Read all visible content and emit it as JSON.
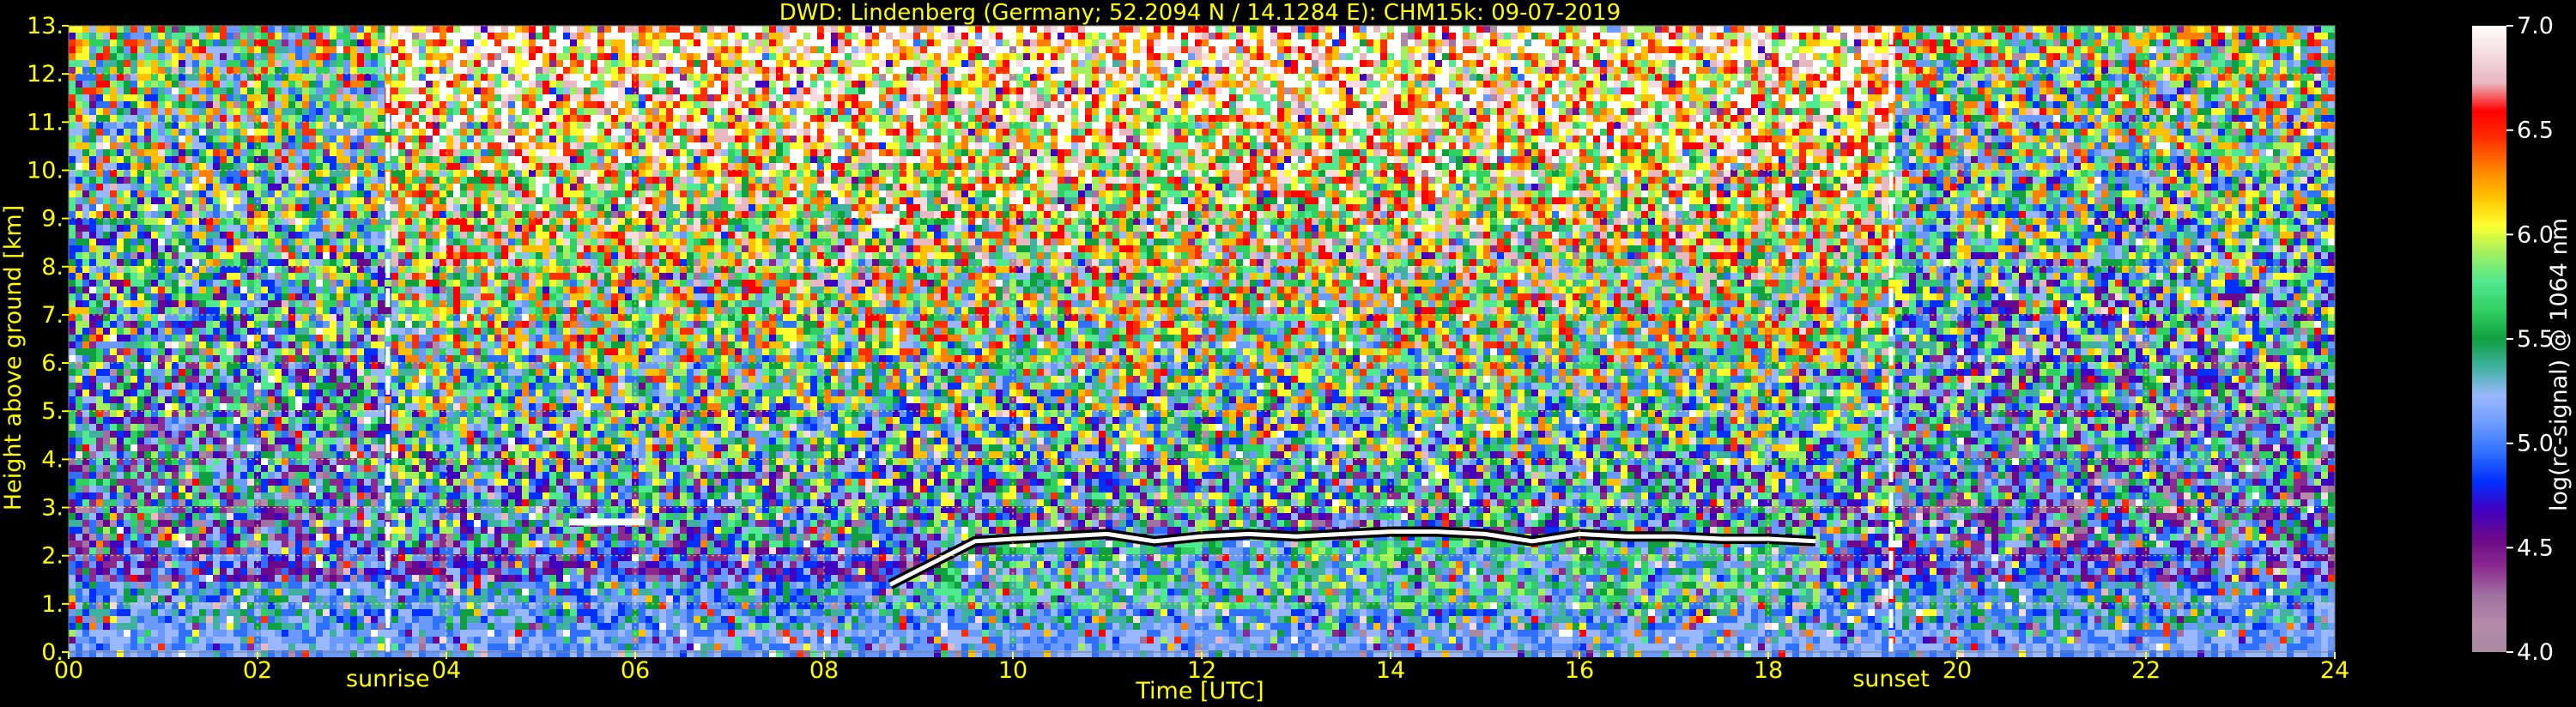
{
  "chart_data": {
    "type": "heatmap",
    "title": "DWD: Lindenberg (Germany; 52.2094 N / 14.1284 E):    CHM15k: 09-07-2019",
    "xlabel": "Time [UTC]",
    "ylabel": "Height above ground [km]",
    "xlim": [
      0,
      24
    ],
    "ylim": [
      0,
      13
    ],
    "x_ticks": [
      0,
      2,
      4,
      6,
      8,
      10,
      12,
      14,
      16,
      18,
      20,
      22,
      24
    ],
    "x_tick_labels": [
      "00",
      "02",
      "04",
      "06",
      "08",
      "10",
      "12",
      "14",
      "16",
      "18",
      "20",
      "22",
      "24"
    ],
    "y_ticks": [
      0,
      1,
      2,
      3,
      4,
      5,
      6,
      7,
      8,
      9,
      10,
      11,
      12,
      13
    ],
    "y_tick_labels": [
      "0.",
      "1.",
      "2.",
      "3.",
      "4.",
      "5.",
      "6.",
      "7.",
      "8.",
      "9.",
      "10.",
      "11.",
      "12.",
      "13."
    ],
    "grid": true,
    "grid_color": "#ffff00",
    "text_color": "#ffff00",
    "background": "#000000",
    "annotations": [
      {
        "label": "sunrise",
        "x": 3.38
      },
      {
        "label": "sunset",
        "x": 19.3
      }
    ],
    "colorbar": {
      "label": "log(rc-signal) @ 1064 nm",
      "range": [
        4.0,
        7.0
      ],
      "ticks": [
        4.0,
        4.5,
        5.0,
        5.5,
        6.0,
        6.5,
        7.0
      ],
      "tick_labels": [
        "4.0",
        "4.5",
        "5.0",
        "5.5",
        "6.0",
        "6.5",
        "7.0"
      ],
      "colors": [
        "#a88ba0",
        "#b48aa8",
        "#a070a0",
        "#8a2a8e",
        "#6a0a8a",
        "#4000c0",
        "#0030ff",
        "#3070ff",
        "#6a9aff",
        "#9ab8ff",
        "#40b0a0",
        "#10a040",
        "#30d060",
        "#50e890",
        "#a0f060",
        "#ffff30",
        "#ffc000",
        "#ff8000",
        "#ff3000",
        "#ff0000",
        "#e8b8c0",
        "#f4dce0",
        "#ffffff"
      ]
    },
    "features": [
      {
        "type": "boundary_layer_top",
        "points": [
          [
            8.7,
            1.4
          ],
          [
            9.0,
            1.7
          ],
          [
            9.3,
            2.0
          ],
          [
            9.6,
            2.3
          ],
          [
            10.0,
            2.35
          ],
          [
            10.5,
            2.4
          ],
          [
            11.0,
            2.45
          ],
          [
            11.5,
            2.3
          ],
          [
            12.0,
            2.4
          ],
          [
            12.5,
            2.45
          ],
          [
            13.0,
            2.4
          ],
          [
            13.5,
            2.45
          ],
          [
            14.0,
            2.5
          ],
          [
            14.5,
            2.5
          ],
          [
            15.0,
            2.45
          ],
          [
            15.5,
            2.3
          ],
          [
            16.0,
            2.45
          ],
          [
            16.5,
            2.4
          ],
          [
            17.0,
            2.4
          ],
          [
            17.5,
            2.35
          ],
          [
            18.0,
            2.35
          ],
          [
            18.5,
            2.3
          ]
        ]
      },
      {
        "type": "cloud_layer",
        "points": [
          [
            5.3,
            2.7
          ],
          [
            6.1,
            2.7
          ]
        ]
      },
      {
        "type": "cloud_patch",
        "points": [
          [
            8.5,
            8.8
          ],
          [
            8.75,
            9.1
          ]
        ]
      }
    ]
  }
}
